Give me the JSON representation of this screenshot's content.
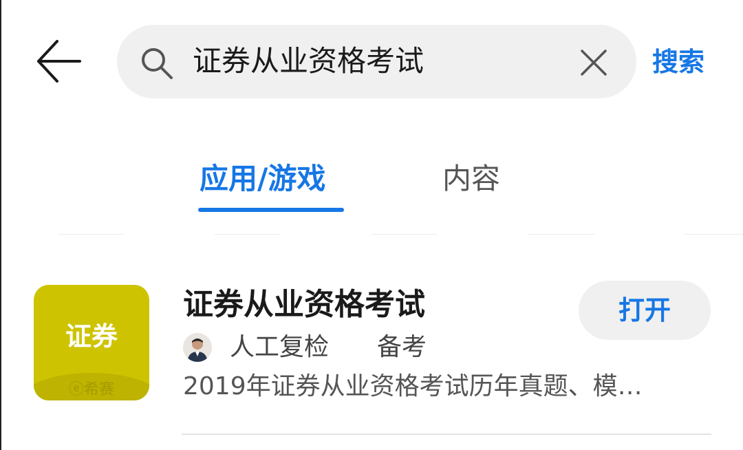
{
  "header": {
    "back_icon": "arrow-left-icon",
    "search": {
      "value": "证券从业资格考试",
      "search_icon": "search-icon",
      "clear_icon": "close-icon"
    },
    "search_button_label": "搜索"
  },
  "tabs": [
    {
      "label": "应用/游戏",
      "selected": true
    },
    {
      "label": "内容",
      "selected": false
    }
  ],
  "results": [
    {
      "icon": {
        "label": "证券",
        "sub_label": "ⓔ希赛",
        "color": "#cdc300"
      },
      "title": "证券从业资格考试",
      "tags": [
        "人工复检",
        "备考"
      ],
      "description": "2019年证券从业资格考试历年真题、模…",
      "action_label": "打开"
    }
  ],
  "colors": {
    "accent": "#1677e5",
    "search_bg": "#f0f0f0",
    "app_icon_bg": "#cdc300"
  }
}
